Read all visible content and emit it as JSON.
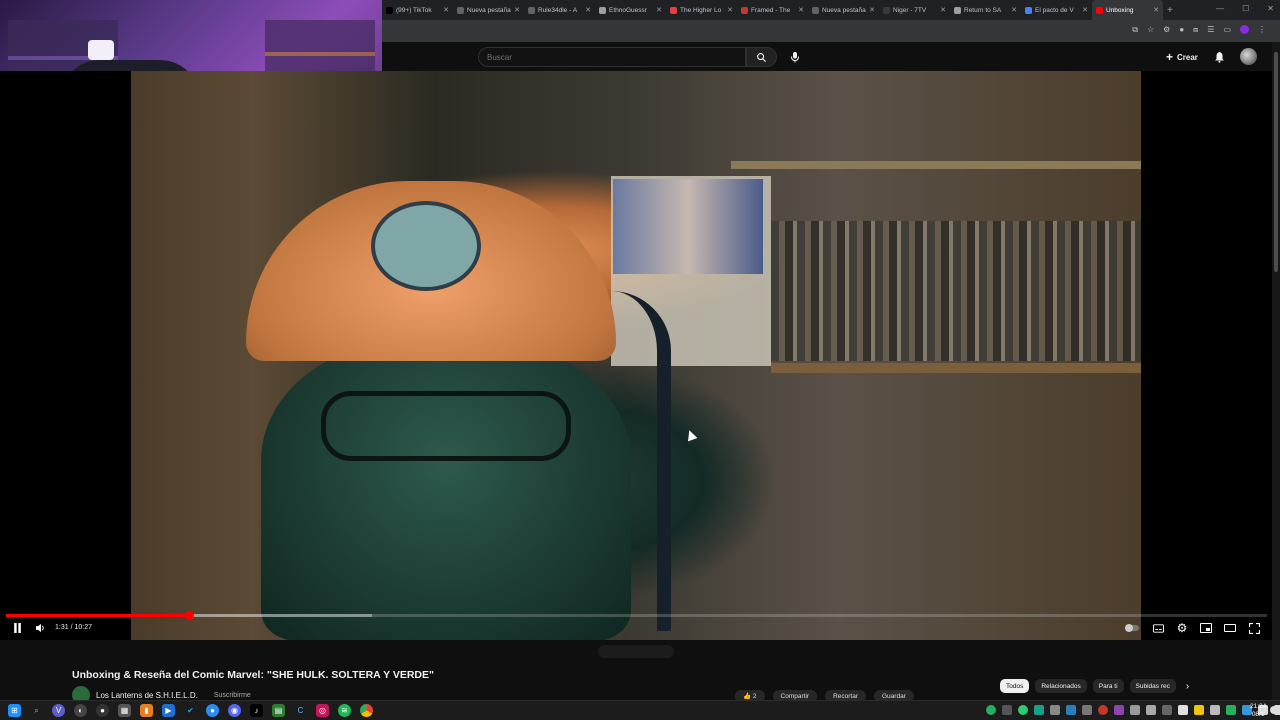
{
  "browser": {
    "tabs": [
      {
        "title": "(99+) TikTok",
        "favicon_color": "#000000"
      },
      {
        "title": "Nueva pestaña",
        "favicon_color": "#5f6368"
      },
      {
        "title": "Rule34dle - A",
        "favicon_color": "#5f6368"
      },
      {
        "title": "EthnoGuessr",
        "favicon_color": "#9aa0a6"
      },
      {
        "title": "The Higher Lo",
        "favicon_color": "#e04040"
      },
      {
        "title": "Framed - The",
        "favicon_color": "#c0392b"
      },
      {
        "title": "Nueva pestaña",
        "favicon_color": "#5f6368"
      },
      {
        "title": "Niger - 7TV",
        "favicon_color": "#3a3a3a"
      },
      {
        "title": "Return to SA",
        "favicon_color": "#9aa0a6"
      },
      {
        "title": "El pacto de V",
        "favicon_color": "#4285f4"
      },
      {
        "title": "Unboxing",
        "favicon_color": "#ff0000",
        "active": true
      }
    ],
    "new_tab_glyph": "+"
  },
  "youtube": {
    "search_placeholder": "Buscar",
    "create_label": "Crear"
  },
  "player": {
    "time_current": "1:31",
    "time_total": "10:27",
    "time_label": "1:31 / 10:27",
    "progress_played_fraction": 0.145,
    "progress_loaded_fraction": 0.29
  },
  "video": {
    "title": "Unboxing & Reseña del Comic Marvel: \"SHE HULK. SOLTERA Y VERDE\"",
    "channel": "Los Lanterns de S.H.I.E.L.D.",
    "subscribe_label": "Suscribirme",
    "actions": [
      "👍 2",
      "Compartir",
      "Recortar",
      "Guardar"
    ],
    "chips": [
      "Todos",
      "Relacionados",
      "Para ti",
      "Subidas rec"
    ]
  },
  "taskbar": {
    "time": "21:24",
    "date": "08/1"
  }
}
